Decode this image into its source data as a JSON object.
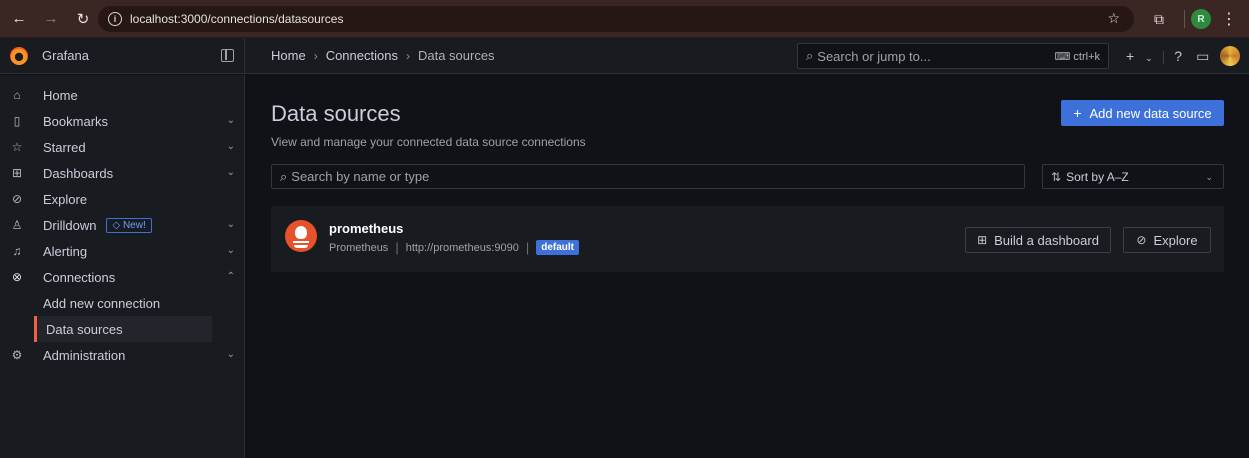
{
  "browser": {
    "url": "localhost:3000/connections/datasources",
    "profile_initial": "R"
  },
  "topbar": {
    "app_name": "Grafana",
    "breadcrumbs": [
      "Home",
      "Connections",
      "Data sources"
    ],
    "search_placeholder": "Search or jump to...",
    "search_shortcut": "ctrl+k",
    "add_label": "+"
  },
  "sidebar": {
    "items": [
      {
        "label": "Home",
        "icon": "home-icon"
      },
      {
        "label": "Bookmarks",
        "icon": "bookmark-icon"
      },
      {
        "label": "Starred",
        "icon": "star-icon"
      },
      {
        "label": "Dashboards",
        "icon": "dashboards-icon"
      },
      {
        "label": "Explore",
        "icon": "compass-icon"
      },
      {
        "label": "Drilldown",
        "icon": "drilldown-icon",
        "badge": "New!"
      },
      {
        "label": "Alerting",
        "icon": "bell-icon"
      },
      {
        "label": "Connections",
        "icon": "connections-icon"
      },
      {
        "label": "Add new connection"
      },
      {
        "label": "Data sources"
      },
      {
        "label": "Administration",
        "icon": "gear-icon"
      }
    ]
  },
  "main": {
    "title": "Data sources",
    "subtitle": "View and manage your connected data source connections",
    "add_button": "Add new data source",
    "filter_placeholder": "Search by name or type",
    "sort_label": "Sort by A–Z",
    "datasource": {
      "name": "prometheus",
      "type": "Prometheus",
      "url": "http://prometheus:9090",
      "badge": "default",
      "build_button": "Build a dashboard",
      "explore_button": "Explore"
    }
  },
  "colors": {
    "accent": "#3d71d9",
    "active_marker": "#f55f3e",
    "prometheus": "#e6522c"
  }
}
